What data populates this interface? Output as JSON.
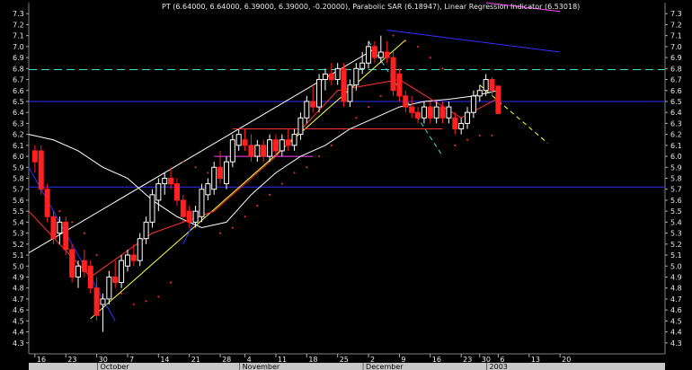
{
  "chart_data": {
    "type": "candlestick",
    "title": "PT (6.64000, 6.64000, 6.39000, 6.39000, -0.20000), Parabolic SAR (6.18947), Linear Regression Indicator (6.53018)",
    "ylim": [
      4.2,
      7.4
    ],
    "xlim": [
      0,
      103
    ],
    "yticks": [
      4.3,
      4.4,
      4.5,
      4.6,
      4.7,
      4.8,
      4.9,
      5.0,
      5.1,
      5.2,
      5.3,
      5.4,
      5.5,
      5.6,
      5.7,
      5.8,
      5.9,
      6.0,
      6.1,
      6.2,
      6.3,
      6.4,
      6.5,
      6.6,
      6.7,
      6.8,
      6.9,
      7.0,
      7.1,
      7.2,
      7.3
    ],
    "ytick_labels": [
      "4.3",
      "4.4",
      "4.5",
      "4.6",
      "4.7",
      "4.8",
      "4.9",
      "5.0",
      "5.1",
      "5.2",
      "5.3",
      "5.4",
      "5.5",
      "5.6",
      "5.7",
      "5.8",
      "5.9",
      "6.0",
      "6.1",
      "6.2",
      "6.3",
      "6.4",
      "6.5",
      "6.6",
      "6.7",
      "6.8",
      "6.9",
      "7.0",
      "7.1",
      "7.2",
      "7.3"
    ],
    "xticks": [
      {
        "x": 1,
        "label": "16"
      },
      {
        "x": 6,
        "label": "23"
      },
      {
        "x": 11,
        "label": "30"
      },
      {
        "x": 16,
        "label": "7"
      },
      {
        "x": 21,
        "label": "14"
      },
      {
        "x": 26,
        "label": "21"
      },
      {
        "x": 31,
        "label": "28"
      },
      {
        "x": 35,
        "label": "4"
      },
      {
        "x": 40,
        "label": "11"
      },
      {
        "x": 45,
        "label": "18"
      },
      {
        "x": 50,
        "label": "25"
      },
      {
        "x": 55,
        "label": "2"
      },
      {
        "x": 60,
        "label": "9"
      },
      {
        "x": 65,
        "label": "16"
      },
      {
        "x": 70,
        "label": "23"
      },
      {
        "x": 73,
        "label": "30"
      },
      {
        "x": 76,
        "label": "6"
      },
      {
        "x": 81,
        "label": "13"
      },
      {
        "x": 86,
        "label": "20"
      }
    ],
    "months": [
      {
        "x": 12,
        "label": "October"
      },
      {
        "x": 35,
        "label": "November"
      },
      {
        "x": 55,
        "label": "December"
      },
      {
        "x": 75,
        "label": "2003"
      }
    ],
    "candles": [
      {
        "x": 1,
        "o": 6.05,
        "h": 6.1,
        "l": 5.85,
        "c": 5.95
      },
      {
        "x": 2,
        "o": 6.05,
        "h": 6.1,
        "l": 5.65,
        "c": 5.7
      },
      {
        "x": 3,
        "o": 5.7,
        "h": 5.75,
        "l": 5.4,
        "c": 5.45
      },
      {
        "x": 4,
        "o": 5.45,
        "h": 5.5,
        "l": 5.2,
        "c": 5.25
      },
      {
        "x": 5,
        "o": 5.3,
        "h": 5.45,
        "l": 5.2,
        "c": 5.4
      },
      {
        "x": 6,
        "o": 5.4,
        "h": 5.45,
        "l": 5.1,
        "c": 5.15
      },
      {
        "x": 7,
        "o": 5.15,
        "h": 5.2,
        "l": 4.85,
        "c": 4.9
      },
      {
        "x": 8,
        "o": 4.9,
        "h": 5.05,
        "l": 4.8,
        "c": 5.0
      },
      {
        "x": 9,
        "o": 5.05,
        "h": 5.15,
        "l": 4.9,
        "c": 4.95
      },
      {
        "x": 10,
        "o": 5.0,
        "h": 5.05,
        "l": 4.75,
        "c": 4.8
      },
      {
        "x": 11,
        "o": 4.8,
        "h": 4.9,
        "l": 4.5,
        "c": 4.55
      },
      {
        "x": 12,
        "o": 4.65,
        "h": 4.75,
        "l": 4.4,
        "c": 4.7
      },
      {
        "x": 13,
        "o": 4.7,
        "h": 4.95,
        "l": 4.65,
        "c": 4.9
      },
      {
        "x": 14,
        "o": 4.9,
        "h": 5.05,
        "l": 4.8,
        "c": 4.85
      },
      {
        "x": 15,
        "o": 4.85,
        "h": 5.1,
        "l": 4.8,
        "c": 5.05
      },
      {
        "x": 16,
        "o": 5.0,
        "h": 5.15,
        "l": 4.95,
        "c": 5.1
      },
      {
        "x": 17,
        "o": 5.1,
        "h": 5.2,
        "l": 5.0,
        "c": 5.05
      },
      {
        "x": 18,
        "o": 5.05,
        "h": 5.3,
        "l": 5.0,
        "c": 5.25
      },
      {
        "x": 19,
        "o": 5.25,
        "h": 5.45,
        "l": 5.2,
        "c": 5.4
      },
      {
        "x": 20,
        "o": 5.4,
        "h": 5.7,
        "l": 5.35,
        "c": 5.65
      },
      {
        "x": 21,
        "o": 5.6,
        "h": 5.8,
        "l": 5.5,
        "c": 5.75
      },
      {
        "x": 22,
        "o": 5.75,
        "h": 5.85,
        "l": 5.65,
        "c": 5.8
      },
      {
        "x": 23,
        "o": 5.8,
        "h": 5.9,
        "l": 5.7,
        "c": 5.75
      },
      {
        "x": 24,
        "o": 5.75,
        "h": 5.8,
        "l": 5.55,
        "c": 5.6
      },
      {
        "x": 25,
        "o": 5.6,
        "h": 5.65,
        "l": 5.4,
        "c": 5.45
      },
      {
        "x": 26,
        "o": 5.5,
        "h": 5.55,
        "l": 5.35,
        "c": 5.4
      },
      {
        "x": 27,
        "o": 5.4,
        "h": 5.55,
        "l": 5.35,
        "c": 5.5
      },
      {
        "x": 28,
        "o": 5.45,
        "h": 5.75,
        "l": 5.4,
        "c": 5.7
      },
      {
        "x": 29,
        "o": 5.65,
        "h": 5.8,
        "l": 5.6,
        "c": 5.75
      },
      {
        "x": 30,
        "o": 5.7,
        "h": 5.95,
        "l": 5.65,
        "c": 5.9
      },
      {
        "x": 31,
        "o": 5.9,
        "h": 6.05,
        "l": 5.75,
        "c": 5.8
      },
      {
        "x": 32,
        "o": 5.75,
        "h": 6.0,
        "l": 5.7,
        "c": 5.95
      },
      {
        "x": 33,
        "o": 5.95,
        "h": 6.2,
        "l": 5.9,
        "c": 6.15
      },
      {
        "x": 34,
        "o": 6.1,
        "h": 6.25,
        "l": 6.05,
        "c": 6.2
      },
      {
        "x": 35,
        "o": 6.15,
        "h": 6.25,
        "l": 6.05,
        "c": 6.1
      },
      {
        "x": 36,
        "o": 6.1,
        "h": 6.2,
        "l": 5.95,
        "c": 6.0
      },
      {
        "x": 37,
        "o": 6.0,
        "h": 6.15,
        "l": 5.95,
        "c": 6.1
      },
      {
        "x": 38,
        "o": 6.1,
        "h": 6.15,
        "l": 5.95,
        "c": 6.0
      },
      {
        "x": 39,
        "o": 6.0,
        "h": 6.2,
        "l": 5.95,
        "c": 6.15
      },
      {
        "x": 40,
        "o": 6.15,
        "h": 6.2,
        "l": 6.0,
        "c": 6.05
      },
      {
        "x": 41,
        "o": 6.05,
        "h": 6.2,
        "l": 6.0,
        "c": 6.15
      },
      {
        "x": 42,
        "o": 6.15,
        "h": 6.25,
        "l": 6.05,
        "c": 6.1
      },
      {
        "x": 43,
        "o": 6.1,
        "h": 6.25,
        "l": 6.05,
        "c": 6.2
      },
      {
        "x": 44,
        "o": 6.2,
        "h": 6.4,
        "l": 6.15,
        "c": 6.35
      },
      {
        "x": 45,
        "o": 6.35,
        "h": 6.55,
        "l": 6.3,
        "c": 6.5
      },
      {
        "x": 46,
        "o": 6.5,
        "h": 6.65,
        "l": 6.4,
        "c": 6.45
      },
      {
        "x": 47,
        "o": 6.45,
        "h": 6.75,
        "l": 6.4,
        "c": 6.7
      },
      {
        "x": 48,
        "o": 6.7,
        "h": 6.8,
        "l": 6.6,
        "c": 6.75
      },
      {
        "x": 49,
        "o": 6.75,
        "h": 6.85,
        "l": 6.65,
        "c": 6.7
      },
      {
        "x": 50,
        "o": 6.7,
        "h": 6.85,
        "l": 6.65,
        "c": 6.8
      },
      {
        "x": 51,
        "o": 6.8,
        "h": 6.85,
        "l": 6.45,
        "c": 6.5
      },
      {
        "x": 52,
        "o": 6.5,
        "h": 6.7,
        "l": 6.45,
        "c": 6.65
      },
      {
        "x": 53,
        "o": 6.65,
        "h": 6.85,
        "l": 6.6,
        "c": 6.8
      },
      {
        "x": 54,
        "o": 6.8,
        "h": 6.95,
        "l": 6.75,
        "c": 6.85
      },
      {
        "x": 55,
        "o": 6.85,
        "h": 7.05,
        "l": 6.8,
        "c": 7.0
      },
      {
        "x": 56,
        "o": 7.0,
        "h": 7.05,
        "l": 6.85,
        "c": 6.9
      },
      {
        "x": 57,
        "o": 6.9,
        "h": 7.1,
        "l": 6.85,
        "c": 6.95
      },
      {
        "x": 58,
        "o": 6.95,
        "h": 7.05,
        "l": 6.85,
        "c": 6.9
      },
      {
        "x": 59,
        "o": 6.9,
        "h": 6.95,
        "l": 6.55,
        "c": 6.6
      },
      {
        "x": 60,
        "o": 6.75,
        "h": 6.8,
        "l": 6.5,
        "c": 6.55
      },
      {
        "x": 61,
        "o": 6.55,
        "h": 6.6,
        "l": 6.4,
        "c": 6.45
      },
      {
        "x": 62,
        "o": 6.45,
        "h": 6.55,
        "l": 6.35,
        "c": 6.4
      },
      {
        "x": 63,
        "o": 6.4,
        "h": 6.45,
        "l": 6.3,
        "c": 6.35
      },
      {
        "x": 64,
        "o": 6.35,
        "h": 6.5,
        "l": 6.3,
        "c": 6.45
      },
      {
        "x": 65,
        "o": 6.45,
        "h": 6.5,
        "l": 6.3,
        "c": 6.35
      },
      {
        "x": 66,
        "o": 6.35,
        "h": 6.5,
        "l": 6.3,
        "c": 6.45
      },
      {
        "x": 67,
        "o": 6.45,
        "h": 6.5,
        "l": 6.3,
        "c": 6.35
      },
      {
        "x": 68,
        "o": 6.35,
        "h": 6.5,
        "l": 6.3,
        "c": 6.45
      },
      {
        "x": 69,
        "o": 6.35,
        "h": 6.4,
        "l": 6.2,
        "c": 6.25
      },
      {
        "x": 70,
        "o": 6.25,
        "h": 6.35,
        "l": 6.2,
        "c": 6.3
      },
      {
        "x": 71,
        "o": 6.3,
        "h": 6.45,
        "l": 6.25,
        "c": 6.4
      },
      {
        "x": 72,
        "o": 6.4,
        "h": 6.6,
        "l": 6.35,
        "c": 6.55
      },
      {
        "x": 73,
        "o": 6.55,
        "h": 6.65,
        "l": 6.5,
        "c": 6.6
      },
      {
        "x": 74,
        "o": 6.6,
        "h": 6.75,
        "l": 6.55,
        "c": 6.7
      },
      {
        "x": 75,
        "o": 6.7,
        "h": 6.72,
        "l": 6.55,
        "c": 6.6
      },
      {
        "x": 76,
        "o": 6.64,
        "h": 6.64,
        "l": 6.39,
        "c": 6.39
      }
    ],
    "bollinger_mid": [
      [
        0,
        6.2
      ],
      [
        4,
        6.15
      ],
      [
        8,
        6.05
      ],
      [
        12,
        5.9
      ],
      [
        16,
        5.8
      ],
      [
        20,
        5.6
      ],
      [
        24,
        5.45
      ],
      [
        28,
        5.35
      ],
      [
        32,
        5.4
      ],
      [
        36,
        5.65
      ],
      [
        40,
        5.85
      ],
      [
        44,
        6.0
      ],
      [
        48,
        6.1
      ],
      [
        52,
        6.25
      ],
      [
        56,
        6.35
      ],
      [
        60,
        6.45
      ],
      [
        64,
        6.5
      ],
      [
        68,
        6.52
      ],
      [
        72,
        6.55
      ],
      [
        76,
        6.6
      ]
    ],
    "parabolic_sar": [
      [
        3,
        5.6
      ],
      [
        5,
        5.5
      ],
      [
        7,
        5.4
      ],
      [
        9,
        5.3
      ],
      [
        11,
        5.1
      ],
      [
        13,
        4.95
      ],
      [
        15,
        4.75
      ],
      [
        17,
        4.65
      ],
      [
        19,
        4.68
      ],
      [
        21,
        4.72
      ],
      [
        23,
        4.85
      ],
      [
        25,
        5.95
      ],
      [
        27,
        5.9
      ],
      [
        29,
        5.85
      ],
      [
        31,
        5.3
      ],
      [
        33,
        5.35
      ],
      [
        35,
        5.45
      ],
      [
        37,
        5.55
      ],
      [
        39,
        5.65
      ],
      [
        41,
        5.75
      ],
      [
        43,
        5.85
      ],
      [
        45,
        5.9
      ],
      [
        47,
        6.0
      ],
      [
        49,
        6.1
      ],
      [
        51,
        6.25
      ],
      [
        53,
        6.35
      ],
      [
        55,
        6.45
      ],
      [
        57,
        6.55
      ],
      [
        59,
        7.1
      ],
      [
        61,
        7.05
      ],
      [
        63,
        7.0
      ],
      [
        65,
        6.9
      ],
      [
        67,
        6.8
      ],
      [
        69,
        6.1
      ],
      [
        71,
        6.15
      ],
      [
        73,
        6.19
      ],
      [
        75,
        6.19
      ]
    ],
    "linear_regression": [
      [
        0,
        5.5
      ],
      [
        10,
        4.9
      ],
      [
        20,
        5.3
      ],
      [
        30,
        5.5
      ],
      [
        40,
        6.0
      ],
      [
        50,
        6.6
      ],
      [
        60,
        6.7
      ],
      [
        70,
        6.35
      ],
      [
        76,
        6.53
      ]
    ],
    "horizontal_levels": [
      {
        "y": 6.5,
        "color": "#3030ff",
        "dash": "solid"
      },
      {
        "y": 5.72,
        "color": "#3030ff",
        "dash": "solid"
      },
      {
        "y": 6.79,
        "color": "#40e0d0",
        "dash": "dashed"
      }
    ],
    "trend_lines": [
      {
        "from": [
          0,
          5.12
        ],
        "to": [
          56,
          6.98
        ],
        "color": "#ffffff",
        "dash": "solid"
      },
      {
        "from": [
          10,
          4.52
        ],
        "to": [
          61,
          7.06
        ],
        "color": "#ffff40",
        "dash": "solid"
      },
      {
        "from": [
          0,
          5.9
        ],
        "to": [
          14,
          4.5
        ],
        "color": "#3030ff",
        "dash": "solid"
      },
      {
        "from": [
          58,
          7.15
        ],
        "to": [
          86,
          6.95
        ],
        "color": "#3030ff",
        "dash": "solid"
      },
      {
        "from": [
          55,
          7.05
        ],
        "to": [
          67,
          6.0
        ],
        "color": "#40e0d0",
        "dash": "dashed"
      },
      {
        "from": [
          73,
          6.65
        ],
        "to": [
          84,
          6.12
        ],
        "color": "#ffff40",
        "dash": "dashed"
      },
      {
        "from": [
          30,
          6.0
        ],
        "to": [
          46,
          6.0
        ],
        "color": "#ff40ff",
        "dash": "solid"
      },
      {
        "from": [
          28,
          5.55
        ],
        "to": [
          25,
          5.2
        ],
        "color": "#3030ff",
        "dash": "solid"
      },
      {
        "from": [
          33,
          6.25
        ],
        "to": [
          67,
          6.25
        ],
        "color": "#ff3030",
        "dash": "solid"
      },
      {
        "from": [
          74,
          7.4
        ],
        "to": [
          86,
          7.32
        ],
        "color": "#ff40ff",
        "dash": "solid"
      }
    ],
    "colors": {
      "up": "#20ff20",
      "down": "#ff2020",
      "background": "#000000",
      "axis_text": "#e8e8e8",
      "bollinger": "#ffffff"
    }
  }
}
